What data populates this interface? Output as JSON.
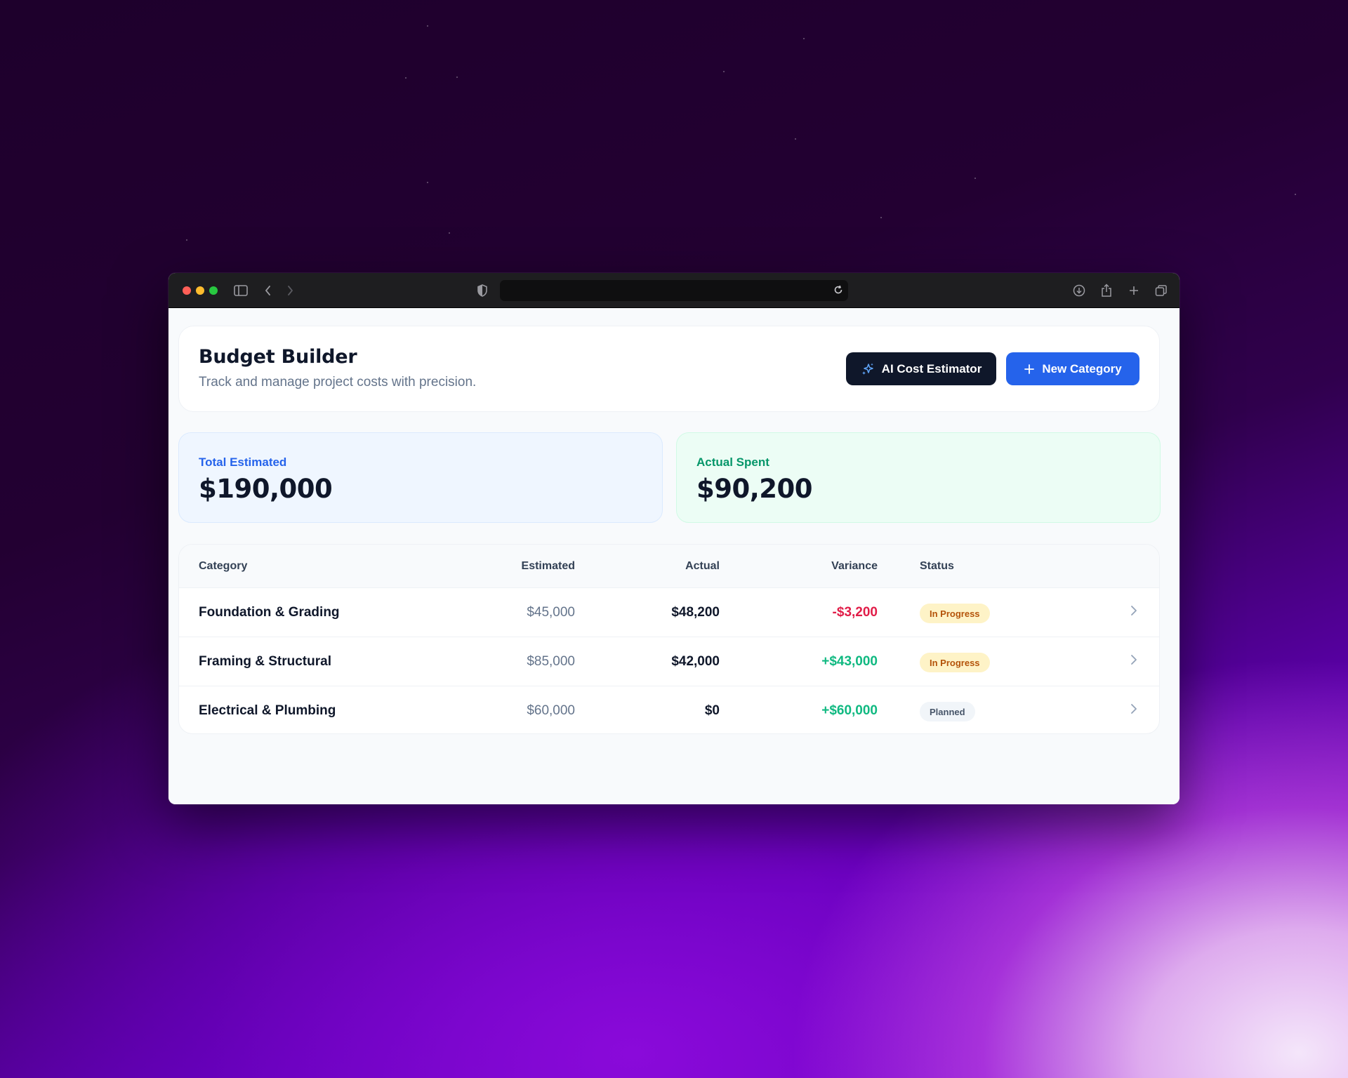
{
  "app": {
    "title": "Budget Builder",
    "subtitle": "Track and manage project costs with precision."
  },
  "actions": {
    "ai_label": "AI Cost Estimator",
    "new_label": "New Category"
  },
  "stats": {
    "estimated_label": "Total Estimated",
    "estimated_value": "$190,000",
    "actual_label": "Actual Spent",
    "actual_value": "$90,200"
  },
  "table": {
    "headers": {
      "category": "Category",
      "estimated": "Estimated",
      "actual": "Actual",
      "variance": "Variance",
      "status": "Status"
    },
    "rows": [
      {
        "category": "Foundation & Grading",
        "estimated": "$45,000",
        "actual": "$48,200",
        "variance": "-$3,200",
        "status": "In Progress"
      },
      {
        "category": "Framing & Structural",
        "estimated": "$85,000",
        "actual": "$42,000",
        "variance": "+$43,000",
        "status": "In Progress"
      },
      {
        "category": "Electrical & Plumbing",
        "estimated": "$60,000",
        "actual": "$0",
        "variance": "+$60,000",
        "status": "Planned"
      }
    ]
  },
  "colors": {
    "accent": "#2563eb",
    "dark": "#0f172a",
    "negative": "#e11d48",
    "positive": "#10b981",
    "estimated_label": "#2563eb",
    "actual_label": "#059669"
  },
  "icons": {
    "ai_button": "sparkles-icon",
    "new_button": "plus-icon",
    "row_action": "chevron-right-icon"
  }
}
